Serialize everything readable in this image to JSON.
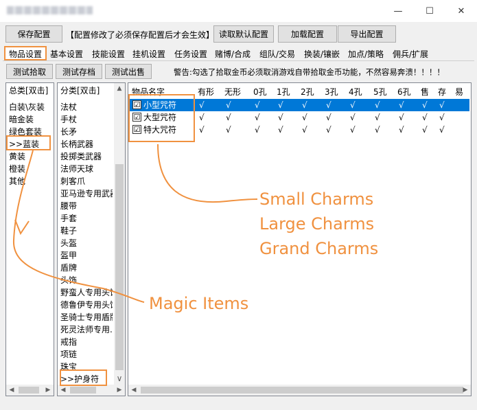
{
  "window": {
    "title": "▒▒▒▒▒▒▒▒▒▒▒",
    "minimize": "—",
    "maximize": "☐",
    "close": "✕"
  },
  "toolbar": {
    "save": "保存配置",
    "notice": "【配置修改了必须保存配置后才会生效】",
    "read_default": "读取默认配置",
    "load": "加载配置",
    "export": "导出配置"
  },
  "tabs": [
    "物品设置",
    "基本设置",
    "技能设置",
    "挂机设置",
    "任务设置",
    "赌博/合成",
    "组队/交易",
    "换装/镶嵌",
    "加点/策略",
    "佣兵/扩展"
  ],
  "subbar": {
    "test_pickup": "测试拾取",
    "test_store": "测试存档",
    "test_sell": "测试出售",
    "warning": "警告:勾选了拾取金币必须取消游戏自带拾取金币功能，不然容易奔溃！！！！"
  },
  "total_list": {
    "header": "总类[双击]",
    "items": [
      "白装\\灰装",
      "暗金装",
      "绿色套装",
      ">>蓝装",
      "黄装",
      "橙装",
      "其他"
    ]
  },
  "category_list": {
    "header": "分类[双击]",
    "items": [
      "法杖",
      "手杖",
      "长矛",
      "长柄武器",
      "投掷类武器",
      "法师天球",
      "刺客爪",
      "亚马逊专用武器",
      "腰带",
      "手套",
      "鞋子",
      "头盔",
      "盔甲",
      "盾牌",
      "头饰",
      "野蛮人专用头饰",
      "德鲁伊专用头饰",
      "圣骑士专用盾牌",
      "死灵法师专用...",
      "戒指",
      "项链",
      "珠宝",
      ">>护身符"
    ]
  },
  "item_table": {
    "columns": [
      "物品名字",
      "有形",
      "无形",
      "0孔",
      "1孔",
      "2孔",
      "3孔",
      "4孔",
      "5孔",
      "6孔",
      "售",
      "存",
      "易"
    ],
    "rows": [
      {
        "name": "小型咒符",
        "checked": "☑",
        "marks": [
          "√",
          "√",
          "√",
          "√",
          "√",
          "√",
          "√",
          "√",
          "√",
          "√",
          "√",
          ""
        ]
      },
      {
        "name": "大型咒符",
        "checked": "☑",
        "marks": [
          "√",
          "√",
          "√",
          "√",
          "√",
          "√",
          "√",
          "√",
          "√",
          "√",
          "√",
          ""
        ]
      },
      {
        "name": "特大咒符",
        "checked": "☑",
        "marks": [
          "√",
          "√",
          "√",
          "√",
          "√",
          "√",
          "√",
          "√",
          "√",
          "√",
          "√",
          ""
        ]
      }
    ]
  },
  "annotations": {
    "small": "Small Charms",
    "large": "Large Charms",
    "grand": "Grand Charms",
    "magic": "Magic Items",
    "color": "#f0913f"
  },
  "icons": {
    "up": "▲",
    "down": "▼",
    "left": "◀",
    "right": "▶",
    "scroll_down": "∨"
  },
  "colors": {
    "selection": "#0078d7",
    "annotation": "#f0913f"
  }
}
